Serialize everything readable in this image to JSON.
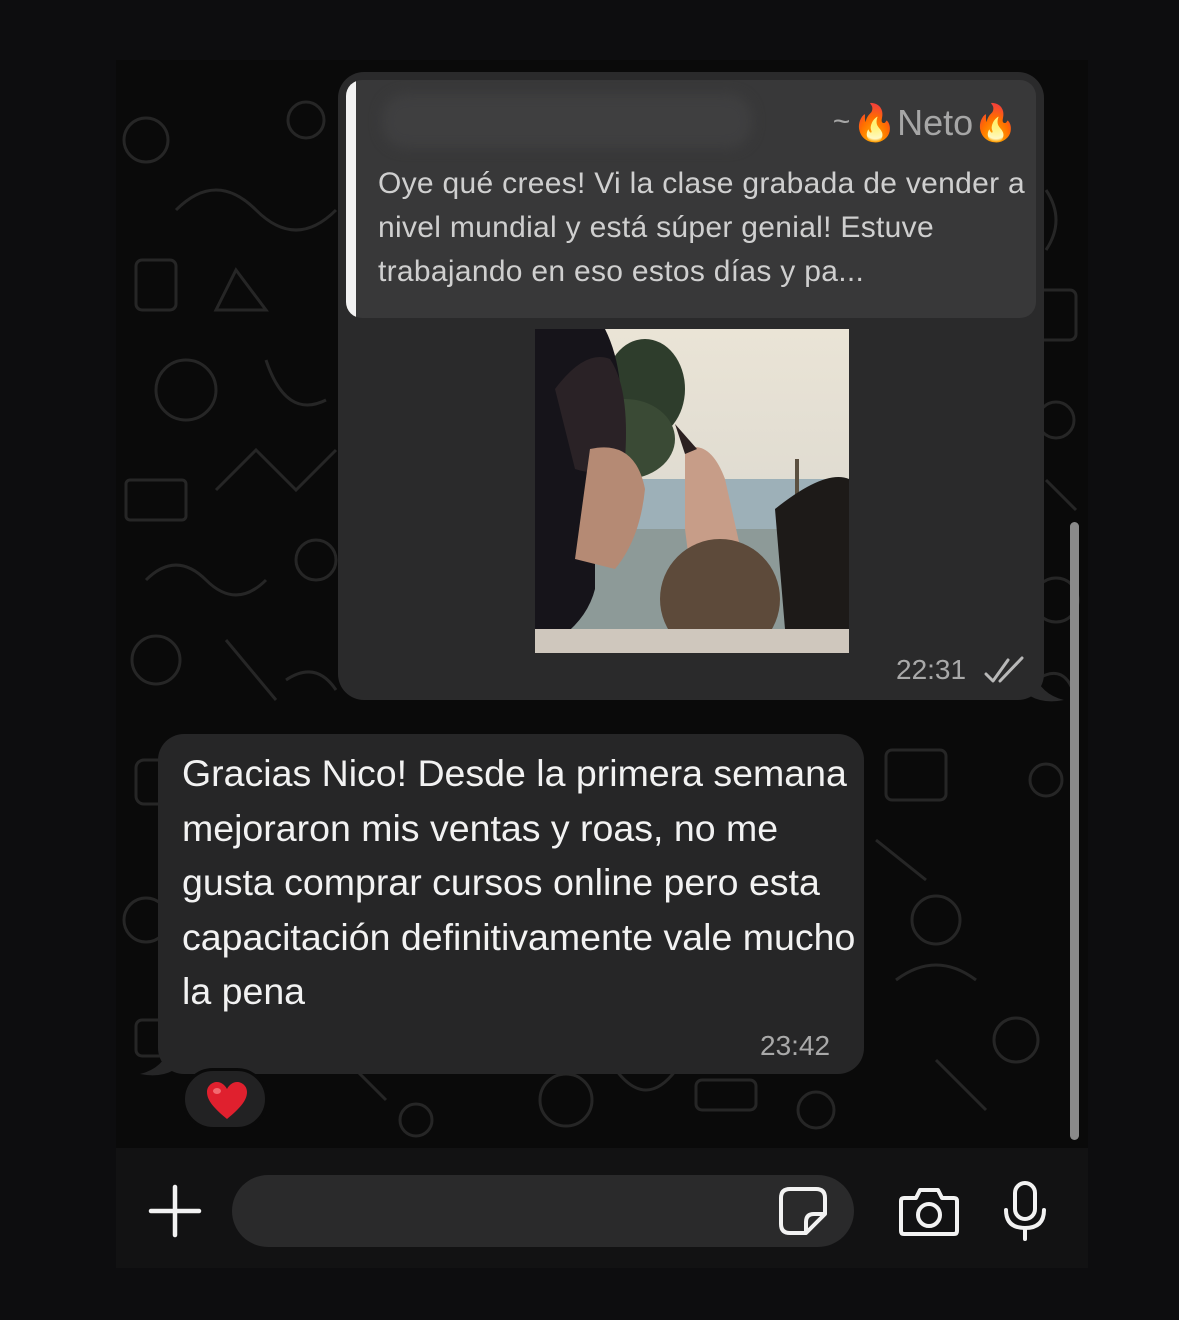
{
  "quoted_message": {
    "author_prefix": "~",
    "author_name": "Neto",
    "author_emoji": "🔥",
    "text": "Oye qué crees! Vi la clase grabada de vender a nivel mundial y está súper genial! Estuve trabajando en eso estos días y pa..."
  },
  "outgoing_message": {
    "media": "photo",
    "time": "22:31",
    "status_icon": "double-check-icon"
  },
  "incoming_message": {
    "text": "Gracias Nico! Desde la primera semana mejoraron mis ventas y roas, no me gusta comprar cursos online pero esta capacitación definitivamente vale mucho la pena",
    "time": "23:42",
    "reaction": "❤️"
  },
  "input_bar": {
    "placeholder": "",
    "icons": [
      "plus-icon",
      "sticker-icon",
      "camera-icon",
      "microphone-icon"
    ]
  },
  "colors": {
    "background": "#0a0a0a",
    "bubble": "#2a2a2b",
    "quote": "#383839",
    "text": "#f2f2f2",
    "muted": "#a9a9a9"
  }
}
